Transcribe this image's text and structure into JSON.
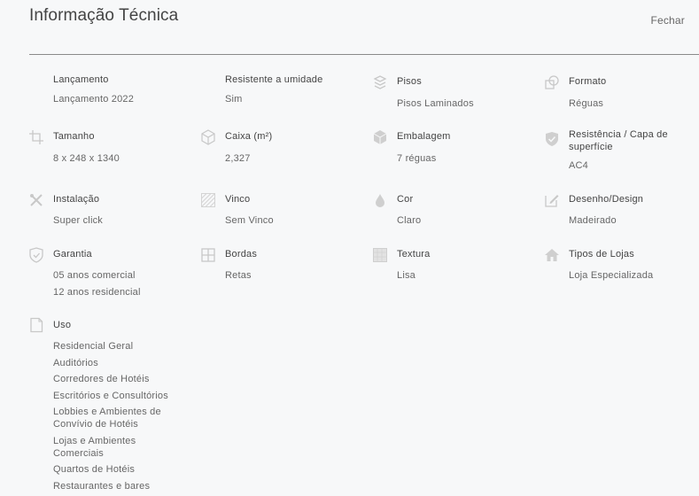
{
  "header": {
    "title": "Informação Técnica",
    "close_label": "Fechar"
  },
  "specs": {
    "lancamento": {
      "label": "Lançamento",
      "values": [
        "Lançamento 2022"
      ]
    },
    "umidade": {
      "label": "Resistente a umidade",
      "values": [
        "Sim"
      ]
    },
    "pisos": {
      "label": "Pisos",
      "icon": "layers-icon",
      "values": [
        "Pisos Laminados"
      ]
    },
    "formato": {
      "label": "Formato",
      "icon": "shapes-icon",
      "values": [
        "Réguas"
      ]
    },
    "tamanho": {
      "label": "Tamanho",
      "icon": "crop-icon",
      "values": [
        "8 x 248 x 1340"
      ]
    },
    "caixa": {
      "label": "Caixa (m²)",
      "icon": "box-icon",
      "values": [
        "2,327"
      ]
    },
    "embalagem": {
      "label": "Embalagem",
      "icon": "package-icon",
      "values": [
        "7 réguas"
      ]
    },
    "resistencia": {
      "label": "Resistência / Capa de superfície",
      "icon": "shield-check-icon",
      "values": [
        "AC4"
      ]
    },
    "instalacao": {
      "label": "Instalação",
      "icon": "tools-icon",
      "values": [
        "Super click"
      ]
    },
    "vinco": {
      "label": "Vinco",
      "icon": "texture-icon",
      "values": [
        "Sem Vinco"
      ]
    },
    "cor": {
      "label": "Cor",
      "icon": "drop-icon",
      "values": [
        "Claro"
      ]
    },
    "desenho": {
      "label": "Desenho/Design",
      "icon": "edit-icon",
      "values": [
        "Madeirado"
      ]
    },
    "garantia": {
      "label": "Garantia",
      "icon": "shield-icon",
      "values": [
        "05 anos comercial",
        "12 anos residencial"
      ]
    },
    "bordas": {
      "label": "Bordas",
      "icon": "grid-icon",
      "values": [
        "Retas"
      ]
    },
    "textura": {
      "label": "Textura",
      "icon": "texture-icon",
      "values": [
        "Lisa"
      ]
    },
    "lojas": {
      "label": "Tipos de Lojas",
      "icon": "home-icon",
      "values": [
        "Loja Especializada"
      ]
    },
    "uso": {
      "label": "Uso",
      "icon": "document-icon",
      "values": [
        "Residencial Geral",
        "Auditórios",
        "Corredores de Hotéis",
        "Escritórios e Consultórios",
        "Lobbies e Ambientes de Convívio de Hotéis",
        "Lojas e Ambientes Comerciais",
        "Quartos de Hotéis",
        "Restaurantes e bares"
      ]
    }
  }
}
